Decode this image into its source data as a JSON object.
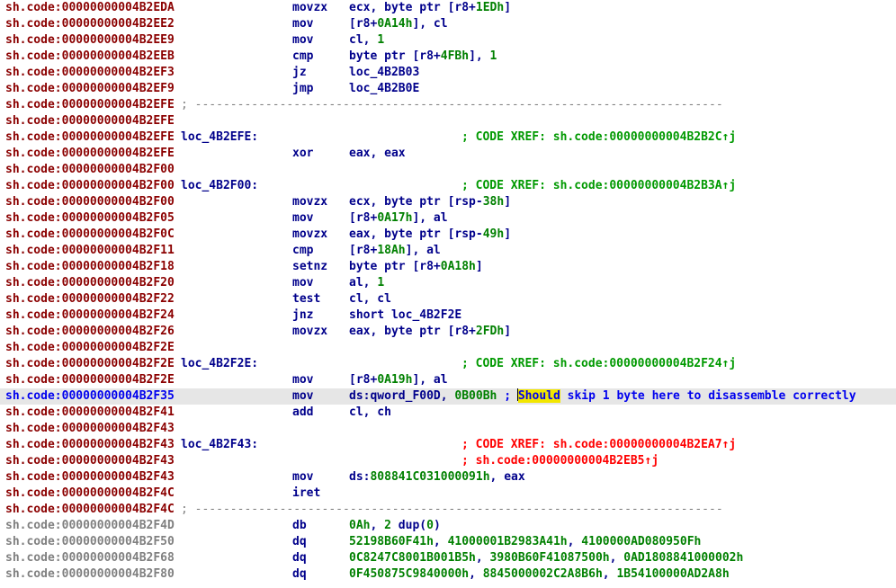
{
  "rows": [
    {
      "addr": "sh.code:00000000004B2EDA",
      "seg": "code",
      "kind": "insn",
      "mn": "movzx",
      "ops": [
        [
          "r",
          "ecx, byte ptr [r8+"
        ],
        [
          "n",
          "1EDh"
        ],
        [
          "r",
          "]"
        ]
      ]
    },
    {
      "addr": "sh.code:00000000004B2EE2",
      "seg": "code",
      "kind": "insn",
      "mn": "mov",
      "ops": [
        [
          "r",
          "[r8+"
        ],
        [
          "n",
          "0A14h"
        ],
        [
          "r",
          "], cl"
        ]
      ]
    },
    {
      "addr": "sh.code:00000000004B2EE9",
      "seg": "code",
      "kind": "insn",
      "mn": "mov",
      "ops": [
        [
          "r",
          "cl, "
        ],
        [
          "n",
          "1"
        ]
      ]
    },
    {
      "addr": "sh.code:00000000004B2EEB",
      "seg": "code",
      "kind": "insn",
      "mn": "cmp",
      "ops": [
        [
          "r",
          "byte ptr [r8+"
        ],
        [
          "n",
          "4FBh"
        ],
        [
          "r",
          "], "
        ],
        [
          "n",
          "1"
        ]
      ]
    },
    {
      "addr": "sh.code:00000000004B2EF3",
      "seg": "code",
      "kind": "insn",
      "mn": "jz",
      "ops": [
        [
          "r",
          "loc_4B2B03"
        ]
      ]
    },
    {
      "addr": "sh.code:00000000004B2EF9",
      "seg": "code",
      "kind": "insn",
      "mn": "jmp",
      "ops": [
        [
          "r",
          "loc_4B2B0E"
        ]
      ]
    },
    {
      "addr": "sh.code:00000000004B2EFE",
      "seg": "code",
      "kind": "sep",
      "text": "; ---------------------------------------------------------------------------"
    },
    {
      "addr": "sh.code:00000000004B2EFE",
      "seg": "code",
      "kind": "blank"
    },
    {
      "addr": "sh.code:00000000004B2EFE",
      "seg": "code",
      "kind": "label",
      "label": "loc_4B2EFE:",
      "xref": "; CODE XREF: sh.code:00000000004B2B2C↑j",
      "xref_color": "green"
    },
    {
      "addr": "sh.code:00000000004B2EFE",
      "seg": "code",
      "kind": "insn",
      "mn": "xor",
      "ops": [
        [
          "r",
          "eax, eax"
        ]
      ]
    },
    {
      "addr": "sh.code:00000000004B2F00",
      "seg": "code",
      "kind": "blank"
    },
    {
      "addr": "sh.code:00000000004B2F00",
      "seg": "code",
      "kind": "label",
      "label": "loc_4B2F00:",
      "xref": "; CODE XREF: sh.code:00000000004B2B3A↑j",
      "xref_color": "green"
    },
    {
      "addr": "sh.code:00000000004B2F00",
      "seg": "code",
      "kind": "insn",
      "mn": "movzx",
      "ops": [
        [
          "r",
          "ecx, byte ptr [rsp-"
        ],
        [
          "n",
          "38h"
        ],
        [
          "r",
          "]"
        ]
      ]
    },
    {
      "addr": "sh.code:00000000004B2F05",
      "seg": "code",
      "kind": "insn",
      "mn": "mov",
      "ops": [
        [
          "r",
          "[r8+"
        ],
        [
          "n",
          "0A17h"
        ],
        [
          "r",
          "], al"
        ]
      ]
    },
    {
      "addr": "sh.code:00000000004B2F0C",
      "seg": "code",
      "kind": "insn",
      "mn": "movzx",
      "ops": [
        [
          "r",
          "eax, byte ptr [rsp-"
        ],
        [
          "n",
          "49h"
        ],
        [
          "r",
          "]"
        ]
      ]
    },
    {
      "addr": "sh.code:00000000004B2F11",
      "seg": "code",
      "kind": "insn",
      "mn": "cmp",
      "ops": [
        [
          "r",
          "[r8+"
        ],
        [
          "n",
          "18Ah"
        ],
        [
          "r",
          "], al"
        ]
      ]
    },
    {
      "addr": "sh.code:00000000004B2F18",
      "seg": "code",
      "kind": "insn",
      "mn": "setnz",
      "ops": [
        [
          "r",
          "byte ptr [r8+"
        ],
        [
          "n",
          "0A18h"
        ],
        [
          "r",
          "]"
        ]
      ]
    },
    {
      "addr": "sh.code:00000000004B2F20",
      "seg": "code",
      "kind": "insn",
      "mn": "mov",
      "ops": [
        [
          "r",
          "al, "
        ],
        [
          "n",
          "1"
        ]
      ]
    },
    {
      "addr": "sh.code:00000000004B2F22",
      "seg": "code",
      "kind": "insn",
      "mn": "test",
      "ops": [
        [
          "r",
          "cl, cl"
        ]
      ]
    },
    {
      "addr": "sh.code:00000000004B2F24",
      "seg": "code",
      "kind": "insn",
      "mn": "jnz",
      "ops": [
        [
          "r",
          "short loc_4B2F2E"
        ]
      ]
    },
    {
      "addr": "sh.code:00000000004B2F26",
      "seg": "code",
      "kind": "insn",
      "mn": "movzx",
      "ops": [
        [
          "r",
          "eax, byte ptr [r8+"
        ],
        [
          "n",
          "2FDh"
        ],
        [
          "r",
          "]"
        ]
      ]
    },
    {
      "addr": "sh.code:00000000004B2F2E",
      "seg": "code",
      "kind": "blank"
    },
    {
      "addr": "sh.code:00000000004B2F2E",
      "seg": "code",
      "kind": "label",
      "label": "loc_4B2F2E:",
      "xref": "; CODE XREF: sh.code:00000000004B2F24↑j",
      "xref_color": "green"
    },
    {
      "addr": "sh.code:00000000004B2F2E",
      "seg": "code",
      "kind": "insn",
      "mn": "mov",
      "ops": [
        [
          "r",
          "[r8+"
        ],
        [
          "n",
          "0A19h"
        ],
        [
          "r",
          "], al"
        ]
      ]
    },
    {
      "addr": "sh.code:00000000004B2F35",
      "seg": "cur",
      "kind": "insn",
      "mn": "mov",
      "highlight": true,
      "ops": [
        [
          "r",
          "ds:qword_F00D, "
        ],
        [
          "n",
          "0B00Bh"
        ],
        [
          "r",
          " "
        ],
        [
          "cm",
          "; "
        ],
        [
          "caret",
          ""
        ],
        [
          "hw",
          "Should"
        ],
        [
          "cm",
          " skip 1 byte here to disassemble correctly"
        ]
      ]
    },
    {
      "addr": "sh.code:00000000004B2F41",
      "seg": "code",
      "kind": "insn",
      "mn": "add",
      "ops": [
        [
          "r",
          "cl, ch"
        ]
      ]
    },
    {
      "addr": "sh.code:00000000004B2F43",
      "seg": "code",
      "kind": "blank"
    },
    {
      "addr": "sh.code:00000000004B2F43",
      "seg": "code",
      "kind": "label",
      "label": "loc_4B2F43:",
      "xref": "; CODE XREF: sh.code:00000000004B2EA7↑j",
      "xref_color": "red"
    },
    {
      "addr": "sh.code:00000000004B2F43",
      "seg": "code",
      "kind": "xref2",
      "xref": "; sh.code:00000000004B2EB5↑j",
      "xref_color": "red"
    },
    {
      "addr": "sh.code:00000000004B2F43",
      "seg": "code",
      "kind": "insn",
      "mn": "mov",
      "ops": [
        [
          "r",
          "ds:"
        ],
        [
          "n",
          "808841C031000091h"
        ],
        [
          "r",
          ", eax"
        ]
      ]
    },
    {
      "addr": "sh.code:00000000004B2F4C",
      "seg": "code",
      "kind": "insn",
      "mn": "iret",
      "ops": []
    },
    {
      "addr": "sh.code:00000000004B2F4C",
      "seg": "code",
      "kind": "sep",
      "text": "; ---------------------------------------------------------------------------"
    },
    {
      "addr": "sh.code:00000000004B2F4D",
      "seg": "data",
      "kind": "insn",
      "mn": "db",
      "ops": [
        [
          "n",
          "0Ah"
        ],
        [
          "r",
          ", "
        ],
        [
          "n",
          "2"
        ],
        [
          "r",
          " dup("
        ],
        [
          "n",
          "0"
        ],
        [
          "r",
          ")"
        ]
      ]
    },
    {
      "addr": "sh.code:00000000004B2F50",
      "seg": "data",
      "kind": "insn",
      "mn": "dq",
      "ops": [
        [
          "n",
          "52198B60F41h"
        ],
        [
          "r",
          ", "
        ],
        [
          "n",
          "41000001B2983A41h"
        ],
        [
          "r",
          ", "
        ],
        [
          "n",
          "4100000AD080950Fh"
        ]
      ]
    },
    {
      "addr": "sh.code:00000000004B2F68",
      "seg": "data",
      "kind": "insn",
      "mn": "dq",
      "ops": [
        [
          "n",
          "0C8247C8001B001B5h"
        ],
        [
          "r",
          ", "
        ],
        [
          "n",
          "3980B60F41087500h"
        ],
        [
          "r",
          ", "
        ],
        [
          "n",
          "0AD1808841000002h"
        ]
      ]
    },
    {
      "addr": "sh.code:00000000004B2F80",
      "seg": "data",
      "kind": "insn",
      "mn": "dq",
      "ops": [
        [
          "n",
          "0F450875C9840000h"
        ],
        [
          "r",
          ", "
        ],
        [
          "n",
          "8845000002C2A8B6h"
        ],
        [
          "r",
          ", "
        ],
        [
          "n",
          "1B54100000AD2A8h"
        ]
      ]
    }
  ]
}
